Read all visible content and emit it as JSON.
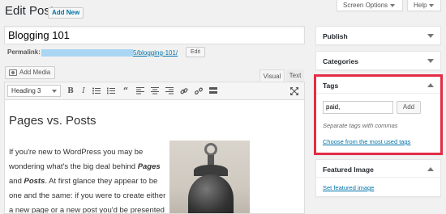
{
  "header": {
    "title": "Edit Post",
    "add_new": "Add New",
    "screen_options": "Screen Options",
    "help": "Help"
  },
  "post": {
    "title_value": "Blogging 101",
    "permalink_label": "Permalink:",
    "permalink_slug": "5/blogging-101/",
    "edit_label": "Edit"
  },
  "editor": {
    "add_media": "Add Media",
    "tabs": {
      "visual": "Visual",
      "text": "Text"
    },
    "format_value": "Heading 3",
    "toolbar_buttons": [
      "bold",
      "italic",
      "bulleted-list",
      "numbered-list",
      "blockquote",
      "align-left",
      "align-center",
      "align-right",
      "link",
      "unlink",
      "toolbar-toggle",
      "fullscreen"
    ],
    "content_heading": "Pages vs. Posts",
    "paragraph_parts": [
      "If you're new to WordPress you may be wondering what's the big deal behind ",
      "Pages",
      " and ",
      "Posts",
      ". At first glance they appear to be one and the same: if you were to create either a new page or a new post you'd be presented"
    ]
  },
  "sidebar": {
    "publish": {
      "title": "Publish"
    },
    "categories": {
      "title": "Categories"
    },
    "tags": {
      "title": "Tags",
      "input_value": "paid,",
      "add_label": "Add",
      "hint": "Separate tags with commas",
      "choose_link": "Choose from the most used tags"
    },
    "featured_image": {
      "title": "Featured Image",
      "set_link": "Set featured image"
    }
  },
  "colors": {
    "link": "#0073aa",
    "highlight_border": "#e32c46",
    "background": "#f1f1f1"
  }
}
